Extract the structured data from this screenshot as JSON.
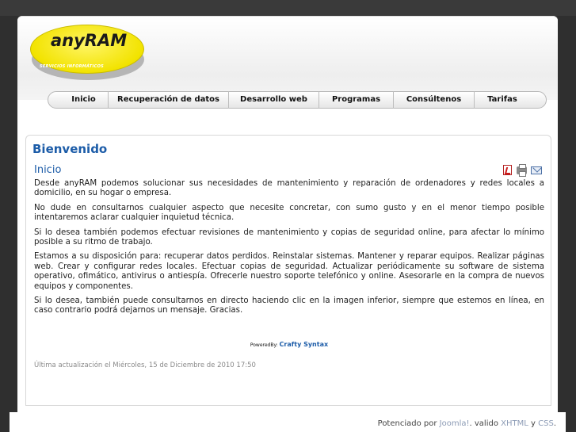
{
  "logo": {
    "word": "anyRAM",
    "subtitle": "SERVICIOS INFORMÁTICOS"
  },
  "nav": {
    "items": [
      {
        "label": "Inicio"
      },
      {
        "label": "Recuperación de datos"
      },
      {
        "label": "Desarrollo web"
      },
      {
        "label": "Programas"
      },
      {
        "label": "Consúltenos"
      },
      {
        "label": "Tarifas"
      }
    ]
  },
  "content": {
    "heading": "Bienvenido",
    "article_title": "Inicio",
    "icons": [
      "pdf-icon",
      "print-icon",
      "email-icon"
    ],
    "paragraphs": [
      "Desde anyRAM podemos solucionar sus necesidades de mantenimiento y reparación de ordenadores y redes locales a domicilio, en su hogar o empresa.",
      "No dude en consultarnos cualquier aspecto que necesite concretar, con sumo gusto y en el menor tiempo posible intentaremos aclarar cualquier inquietud técnica.",
      "Si lo desea también podemos efectuar revisiones de mantenimiento y copias de seguridad online, para afectar lo mínimo posible a su ritmo de trabajo.",
      "Estamos a su disposición para: recuperar datos perdidos. Reinstalar sistemas. Mantener y reparar equipos. Realizar páginas web. Crear y configurar redes locales. Efectuar copias de seguridad. Actualizar periódicamente su software de sistema operativo, ofimático, antivirus o antiespía. Ofrecerle nuestro soporte telefónico y online. Asesorarle en la compra de nuevos equipos y componentes.",
      "Si lo desea, también puede consultarnos en directo haciendo clic en la imagen inferior, siempre que estemos en línea, en caso contrario podrá dejarnos un mensaje. Gracias."
    ],
    "powered_prefix": "PoweredBy:",
    "powered_link": "Crafty Syntax",
    "last_updated": "Última actualización el Miércoles, 15 de Diciembre de 2010 17:50"
  },
  "footer": {
    "prefix": "Potenciado por",
    "joomla": "Joomla!",
    "valid": ". valido",
    "xhtml": "XHTML",
    "and": "y",
    "css": "CSS",
    "end": "."
  },
  "colors": {
    "background": "#2f2f2f",
    "heading_blue": "#1c5ca8",
    "logo_yellow": "#f2e300"
  }
}
